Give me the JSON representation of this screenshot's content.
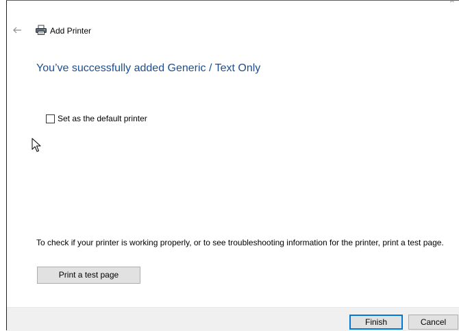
{
  "window": {
    "title": "Add Printer",
    "close_glyph": "×"
  },
  "main": {
    "heading": "You’ve successfully added Generic / Text Only",
    "default_printer_checkbox": {
      "label": "Set as the default printer",
      "checked": false
    },
    "info_text": "To check if your printer is working properly, or to see troubleshooting information for the printer, print a test page.",
    "print_test_label": "Print a test page"
  },
  "footer": {
    "finish_label": "Finish",
    "cancel_label": "Cancel"
  },
  "icons": {
    "back": "back-arrow-icon",
    "printer": "printer-icon",
    "cursor": "mouse-pointer-icon",
    "close": "close-icon"
  },
  "colors": {
    "heading": "#1e4e8c",
    "footer_bg": "#f0f0f0",
    "button_bg": "#e1e1e1",
    "default_button_border": "#0078d7"
  }
}
